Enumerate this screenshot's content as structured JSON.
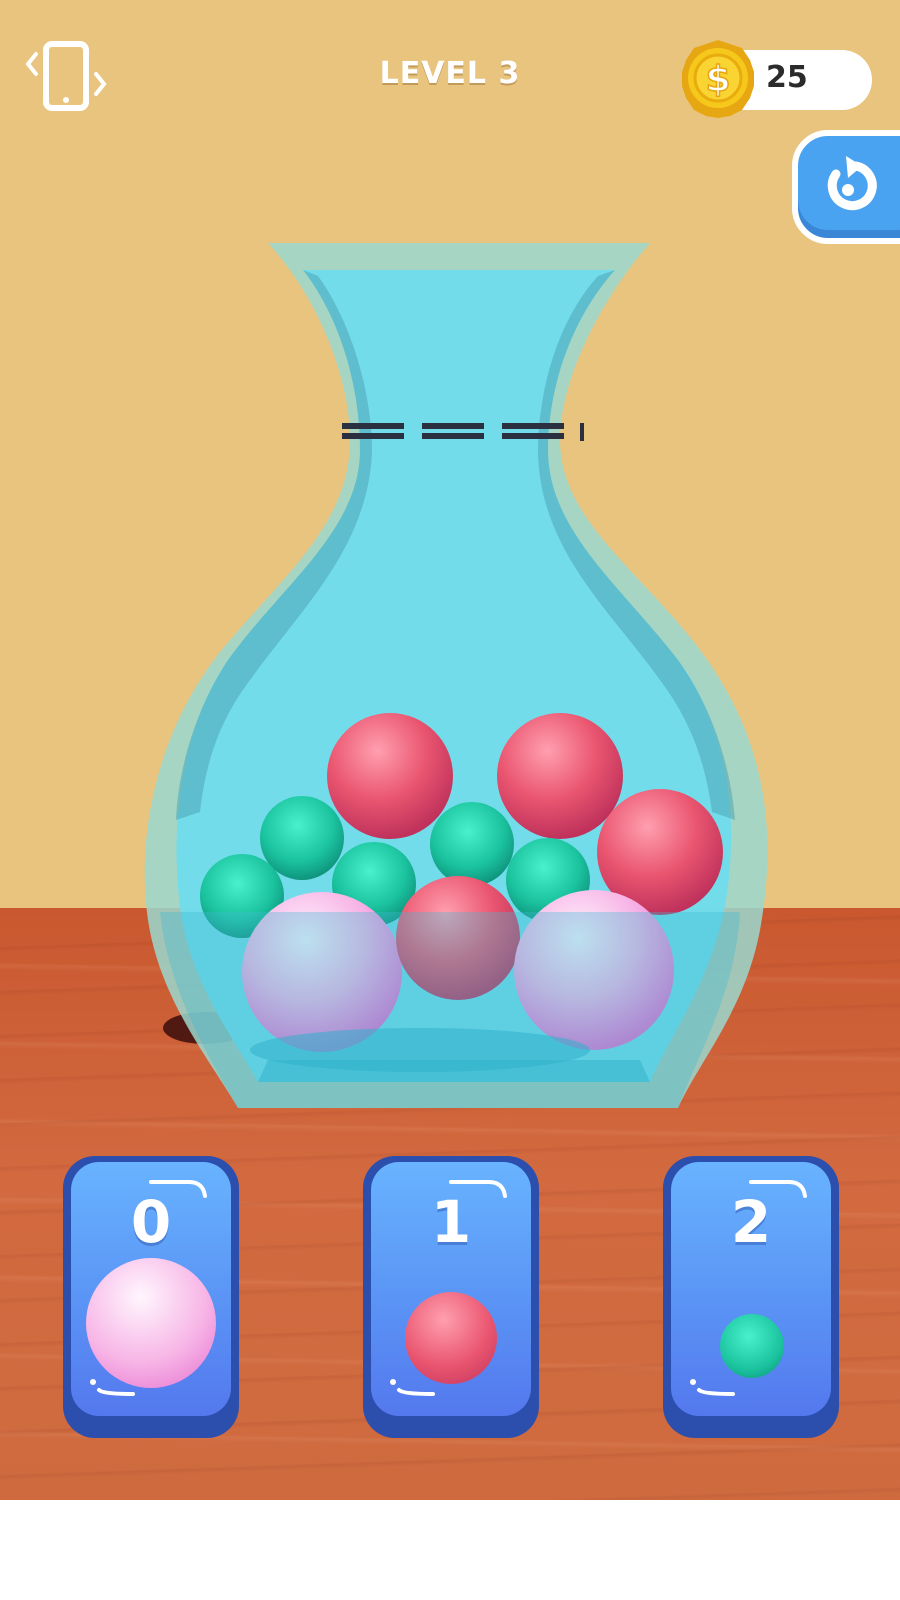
{
  "header": {
    "level_label": "LEVEL 3",
    "coins": "25",
    "coin_symbol": "$"
  },
  "icons": {
    "vibrate": "vibrate-phone-icon",
    "coin": "coin-icon",
    "restart": "restart-icon"
  },
  "cards": [
    {
      "number": "0",
      "ball_color": "pink",
      "ball": "large"
    },
    {
      "number": "1",
      "ball_color": "red",
      "ball": "medium"
    },
    {
      "number": "2",
      "ball_color": "green",
      "ball": "small"
    }
  ],
  "colors": {
    "wall": "#e9c47f",
    "table": "#cf6a3f",
    "vase_glass": "#6fdcec",
    "pink_ball": "#f7b5e6",
    "red_ball": "#e8506e",
    "green_ball": "#1fc9a3",
    "card_blue": "#5a94f5",
    "card_border": "#2c4fae",
    "coin_gold": "#f6c81b"
  }
}
